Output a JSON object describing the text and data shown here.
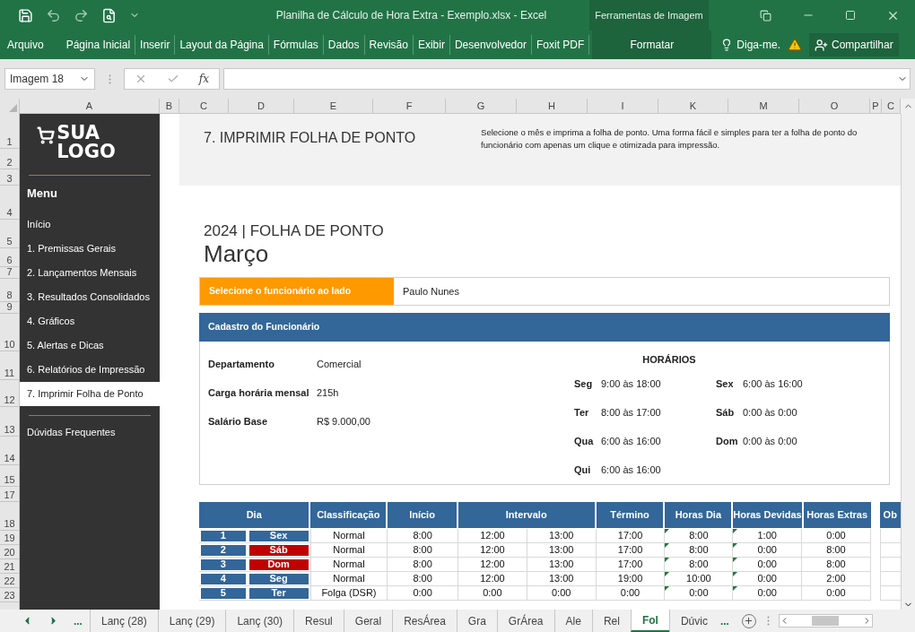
{
  "title_bar": {
    "title": "Planilha de Cálculo de Hora Extra - Exemplo.xlsx - Excel",
    "context_group": "Ferramentas de Imagem"
  },
  "ribbon_tabs": [
    {
      "label": "Arquivo",
      "selected": false,
      "kind": "file"
    },
    {
      "label": "Página Inicial",
      "selected": false,
      "kind": "tab"
    },
    {
      "label": "Inserir",
      "selected": false,
      "kind": "tab"
    },
    {
      "label": "Layout da Página",
      "selected": false,
      "kind": "tab"
    },
    {
      "label": "Fórmulas",
      "selected": false,
      "kind": "tab"
    },
    {
      "label": "Dados",
      "selected": false,
      "kind": "tab"
    },
    {
      "label": "Revisão",
      "selected": false,
      "kind": "tab"
    },
    {
      "label": "Exibir",
      "selected": false,
      "kind": "tab"
    },
    {
      "label": "Desenvolvedor",
      "selected": false,
      "kind": "tab"
    },
    {
      "label": "Foxit PDF",
      "selected": false,
      "kind": "tab"
    },
    {
      "label": "Formatar",
      "selected": false,
      "kind": "context"
    }
  ],
  "tell_me": "Diga-me.",
  "share": "Compartilhar",
  "name_box": "Imagem 18",
  "fx": "fx",
  "column_headers": [
    "A",
    "B",
    "C",
    "D",
    "E",
    "F",
    "G",
    "H",
    "I",
    "K",
    "M",
    "O",
    "P",
    "C"
  ],
  "row_headers": [
    "1",
    "2",
    "3",
    "4",
    "5",
    "6",
    "7",
    "8",
    "9",
    "10",
    "11",
    "12",
    "13",
    "14",
    "15",
    "17",
    "18",
    "19",
    "20",
    "21",
    "22",
    "23"
  ],
  "sidebar": {
    "logo_top": "SUA",
    "logo_bottom": "LOGO",
    "heading": "Menu",
    "items": [
      {
        "label": "Início",
        "selected": false
      },
      {
        "label": "1. Premissas Gerais",
        "selected": false
      },
      {
        "label": "2. Lançamentos Mensais",
        "selected": false
      },
      {
        "label": "3. Resultados Consolidados",
        "selected": false
      },
      {
        "label": "4. Gráficos",
        "selected": false
      },
      {
        "label": "5. Alertas e Dicas",
        "selected": false
      },
      {
        "label": "6. Relatórios de Impressão",
        "selected": false
      },
      {
        "label": "7. Imprimir Folha de Ponto",
        "selected": true
      }
    ],
    "footer_item": "Dúvidas Frequentes"
  },
  "page": {
    "section_title": "7. IMPRIMIR FOLHA DE PONTO",
    "description": "Selecione o mês e imprima a folha de ponto. Uma forma fácil e simples para ter a folha de ponto do funcionário com apenas um clique e otimizada para impressão.",
    "year_title": "2024 | FOLHA DE PONTO",
    "month": "Março",
    "employee_prompt": "Selecione o funcionário ao lado",
    "employee": "Paulo Nunes",
    "card_title": "Cadastro do Funcionário",
    "fields": [
      {
        "label": "Departamento",
        "value": "Comercial"
      },
      {
        "label": "Carga horária mensal",
        "value": "215h"
      },
      {
        "label": "Salário Base",
        "value": "R$ 9.000,00"
      }
    ],
    "schedule_title": "HORÁRIOS",
    "schedule_columns": [
      [
        {
          "day": "Seg",
          "hours": "9:00 às 18:00"
        },
        {
          "day": "Ter",
          "hours": "8:00 às 17:00"
        },
        {
          "day": "Qua",
          "hours": "6:00 às 16:00"
        },
        {
          "day": "Qui",
          "hours": "6:00 às 16:00"
        }
      ],
      [
        {
          "day": "Sex",
          "hours": "6:00 às 16:00"
        },
        {
          "day": "Sáb",
          "hours": "0:00 às 0:00"
        },
        {
          "day": "Dom",
          "hours": "0:00 às 0:00"
        }
      ]
    ]
  },
  "table": {
    "columns": [
      "Dia",
      "Classificação",
      "Início",
      "Intervalo",
      "Término",
      "Horas Dia",
      "Horas Devidas",
      "Horas Extras",
      "Ob"
    ],
    "rows": [
      {
        "n": "1",
        "day": "Sex",
        "color": "#336699",
        "classification": "Normal",
        "start": "8:00",
        "break_start": "12:00",
        "break_end": "13:00",
        "end": "17:00",
        "hours": "8:00",
        "owed": "1:00",
        "extra": "0:00",
        "flagged": true
      },
      {
        "n": "2",
        "day": "Sáb",
        "color": "#c00000",
        "classification": "Normal",
        "start": "8:00",
        "break_start": "12:00",
        "break_end": "13:00",
        "end": "17:00",
        "hours": "8:00",
        "owed": "0:00",
        "extra": "8:00",
        "flagged": true
      },
      {
        "n": "3",
        "day": "Dom",
        "color": "#c00000",
        "classification": "Normal",
        "start": "8:00",
        "break_start": "12:00",
        "break_end": "13:00",
        "end": "17:00",
        "hours": "8:00",
        "owed": "0:00",
        "extra": "8:00",
        "flagged": true
      },
      {
        "n": "4",
        "day": "Seg",
        "color": "#336699",
        "classification": "Normal",
        "start": "8:00",
        "break_start": "12:00",
        "break_end": "13:00",
        "end": "19:00",
        "hours": "10:00",
        "owed": "0:00",
        "extra": "2:00",
        "flagged": true
      },
      {
        "n": "5",
        "day": "Ter",
        "color": "#336699",
        "classification": "Folga (DSR)",
        "start": "0:00",
        "break_start": "0:00",
        "break_end": "0:00",
        "end": "0:00",
        "hours": "0:00",
        "owed": "0:00",
        "extra": "0:00",
        "flagged": true
      }
    ]
  },
  "sheet_tabs": [
    {
      "label": "Lanç (28)",
      "selected": false
    },
    {
      "label": "Lanç (29)",
      "selected": false
    },
    {
      "label": "Lanç (30)",
      "selected": false
    },
    {
      "label": "Resul",
      "selected": false
    },
    {
      "label": "Geral",
      "selected": false
    },
    {
      "label": "ResÁrea",
      "selected": false
    },
    {
      "label": "Gra",
      "selected": false
    },
    {
      "label": "GrÁrea",
      "selected": false
    },
    {
      "label": "Ale",
      "selected": false
    },
    {
      "label": "Rel",
      "selected": false
    },
    {
      "label": "Fol",
      "selected": true
    },
    {
      "label": "Dúvic",
      "selected": false
    }
  ],
  "sheet_more": "...",
  "sheet_more_right": "..."
}
